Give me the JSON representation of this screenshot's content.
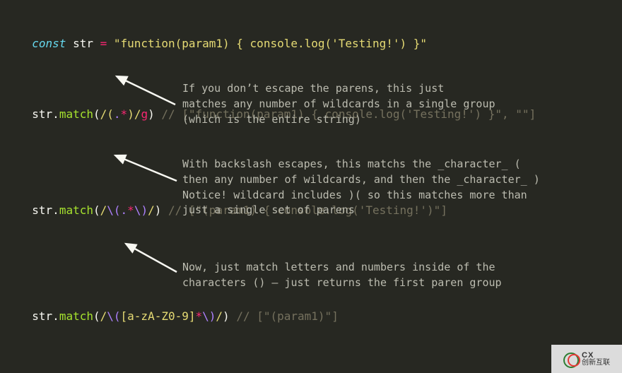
{
  "line1": {
    "kw": "const",
    "name": " str ",
    "eq": "=",
    "sp": " ",
    "str": "\"function(param1) { console.log('Testing!') }\""
  },
  "ex1": {
    "obj": "str",
    "dot": ".",
    "method": "match",
    "lp": "(",
    "d1": "/",
    "gp1": "(",
    "wild": ".",
    "star": "*",
    "gp2": ")",
    "d2": "/",
    "flag": "g",
    "rp": ")",
    "sp": " ",
    "cmt": "// [\"function(param1) { console.log('Testing!') }\", \"\"]"
  },
  "anno1": "If you don’t escape the parens, this just\nmatches any number of wildcards in a single group\n(which is the entire string)",
  "ex2": {
    "obj": "str",
    "dot": ".",
    "method": "match",
    "lp": "(",
    "d1": "/",
    "esc1": "\\(",
    "wild": ".",
    "star": "*",
    "esc2": "\\)",
    "d2": "/",
    "rp": ")",
    "sp": " ",
    "cmt": "// [\"(param1) { console.log('Testing!')\"]"
  },
  "anno2": "With backslash escapes, this matchs the _character_ (\nthen any number of wildcards, and then the _character_ )\nNotice! wildcard includes )( so this matches more than\njust a single set of parens",
  "ex3": {
    "obj": "str",
    "dot": ".",
    "method": "match",
    "lp": "(",
    "d1": "/",
    "esc1": "\\(",
    "cls": "[a-zA-Z0-9]",
    "star": "*",
    "esc2": "\\)",
    "d2": "/",
    "rp": ")",
    "sp": " ",
    "cmt": "// [\"(param1)\"]"
  },
  "anno3": "Now, just match letters and numbers inside of the\ncharacters () – just returns the first paren group",
  "watermark": {
    "brand_en": "CX",
    "brand_cn": "创新互联"
  }
}
